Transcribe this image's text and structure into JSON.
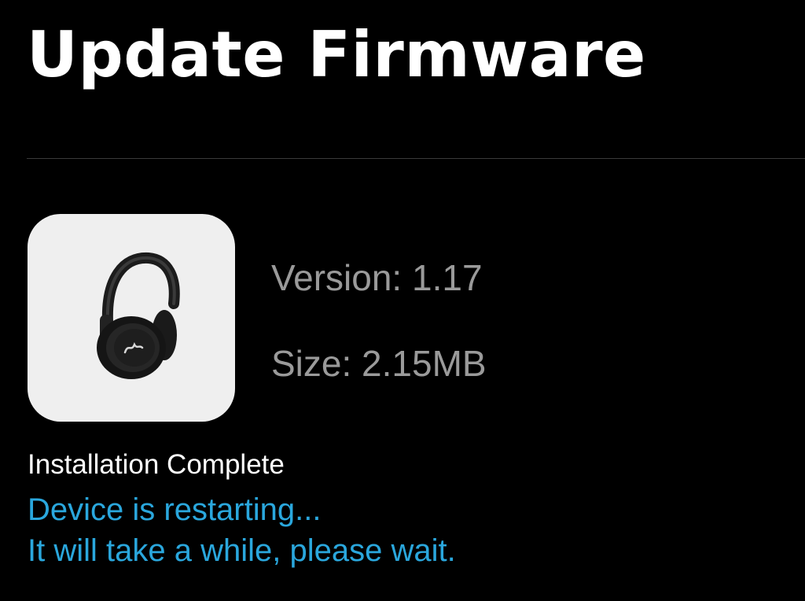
{
  "header": {
    "title": "Update Firmware"
  },
  "firmware": {
    "image_icon": "headphones-icon",
    "version_text": "Version: 1.17",
    "size_text": "Size: 2.15MB"
  },
  "status": {
    "label": "Installation Complete",
    "message_line1": "Device is restarting...",
    "message_line2": "It will take a while, please wait."
  },
  "colors": {
    "background": "#000000",
    "title": "#ffffff",
    "info_text": "#9a9a9a",
    "accent": "#2aa7dd",
    "tile": "#efefef"
  }
}
